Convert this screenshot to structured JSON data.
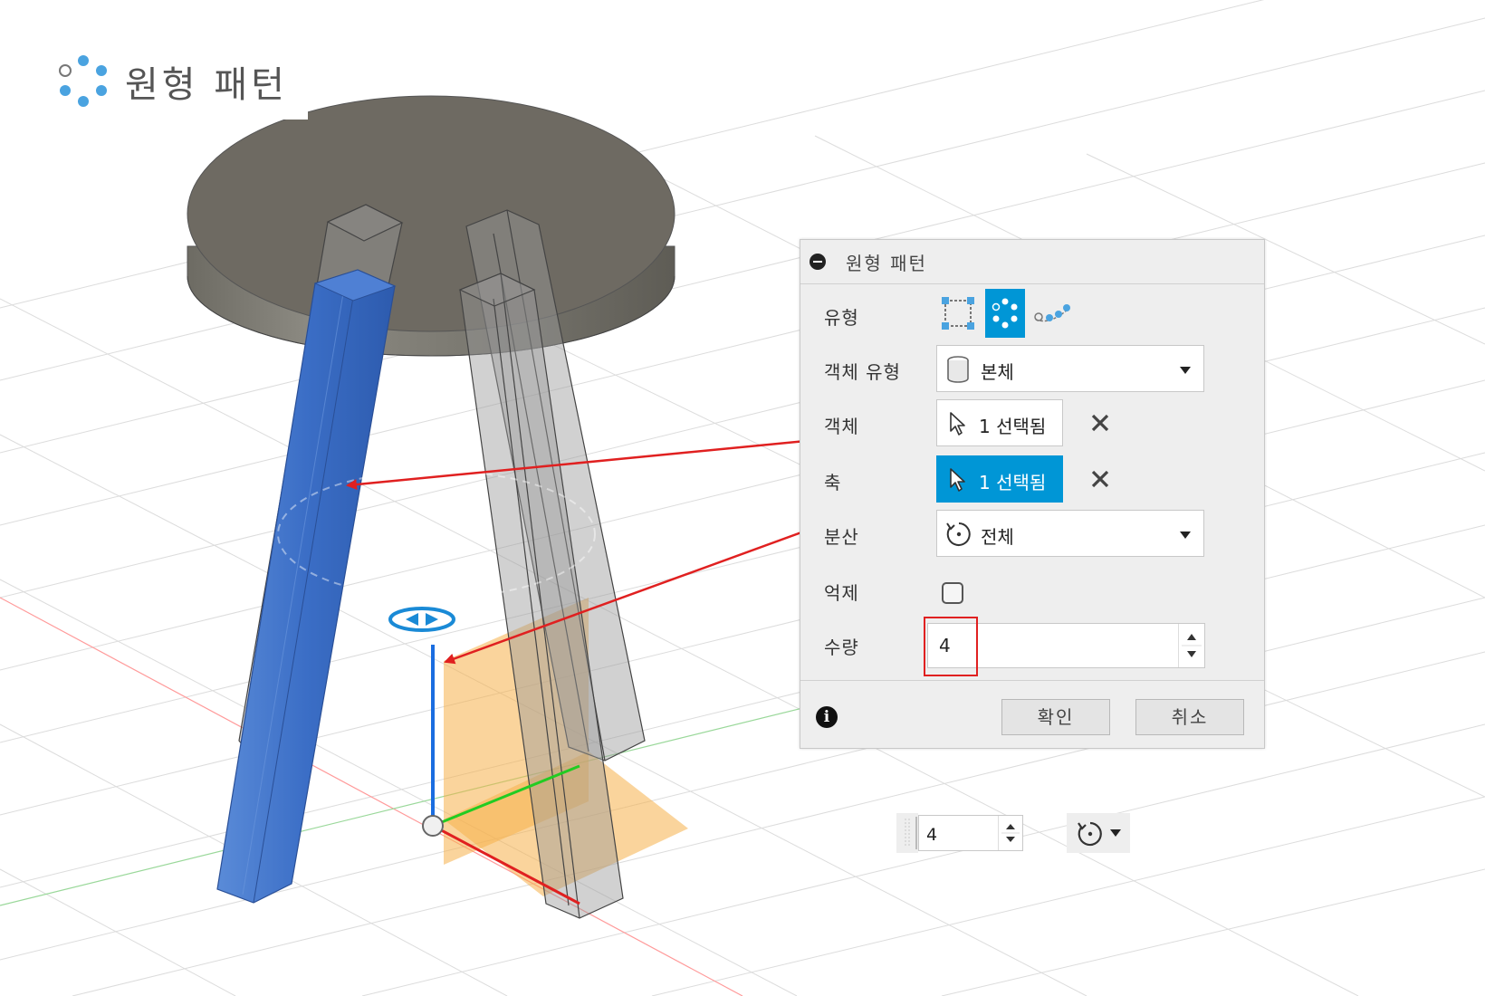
{
  "title": "원형 패턴",
  "panel": {
    "title": "원형 패턴",
    "type_label": "유형",
    "type_options": [
      "rectangular-pattern-icon",
      "circular-pattern-icon",
      "path-pattern-icon"
    ],
    "type_selected": "circular-pattern-icon",
    "object_type_label": "객체 유형",
    "object_type_value": "본체",
    "objects_label": "객체",
    "objects_value": "1 선택됨",
    "axis_label": "축",
    "axis_value": "1 선택됨",
    "distribution_label": "분산",
    "distribution_value": "전체",
    "suppress_label": "억제",
    "suppress_checked": false,
    "quantity_label": "수량",
    "quantity_value": "4",
    "ok_label": "확인",
    "cancel_label": "취소"
  },
  "canvas_input": {
    "quantity_value": "4"
  },
  "colors": {
    "accent": "#0096d6",
    "selected_body": "#3a6fc4",
    "annotation": "#e02020",
    "plane": "#f5b04a",
    "disc_top": "#6e6a62"
  }
}
